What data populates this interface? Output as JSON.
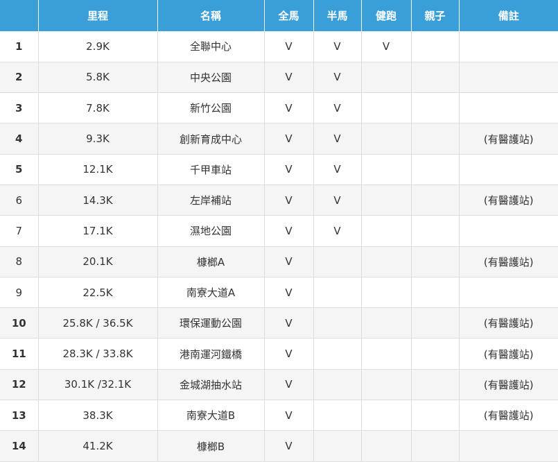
{
  "header": [
    "",
    "里程",
    "名稱",
    "全馬",
    "半馬",
    "健跑",
    "親子",
    "備註"
  ],
  "rows": [
    {
      "idx": "1",
      "bold": true,
      "dist": "2.9K",
      "name": "全聯中心",
      "full": "V",
      "half": "V",
      "fun": "V",
      "kids": "",
      "note": ""
    },
    {
      "idx": "2",
      "bold": true,
      "dist": "5.8K",
      "name": "中央公園",
      "full": "V",
      "half": "V",
      "fun": "",
      "kids": "",
      "note": ""
    },
    {
      "idx": "3",
      "bold": true,
      "dist": "7.8K",
      "name": "新竹公園",
      "full": "V",
      "half": "V",
      "fun": "",
      "kids": "",
      "note": ""
    },
    {
      "idx": "4",
      "bold": true,
      "dist": "9.3K",
      "name": "創新育成中心",
      "full": "V",
      "half": "V",
      "fun": "",
      "kids": "",
      "note": "(有醫護站)"
    },
    {
      "idx": "5",
      "bold": true,
      "dist": "12.1K",
      "name": "千甲車站",
      "full": "V",
      "half": "V",
      "fun": "",
      "kids": "",
      "note": ""
    },
    {
      "idx": "6",
      "bold": false,
      "dist": "14.3K",
      "name": "左岸補站",
      "full": "V",
      "half": "V",
      "fun": "",
      "kids": "",
      "note": "(有醫護站)"
    },
    {
      "idx": "7",
      "bold": false,
      "dist": "17.1K",
      "name": "濕地公園",
      "full": "V",
      "half": "V",
      "fun": "",
      "kids": "",
      "note": ""
    },
    {
      "idx": "8",
      "bold": false,
      "dist": "20.1K",
      "name": "槺榔A",
      "full": "V",
      "half": "",
      "fun": "",
      "kids": "",
      "note": "(有醫護站)"
    },
    {
      "idx": "9",
      "bold": false,
      "dist": "22.5K",
      "name": "南寮大道A",
      "full": "V",
      "half": "",
      "fun": "",
      "kids": "",
      "note": ""
    },
    {
      "idx": "10",
      "bold": true,
      "dist": "25.8K / 36.5K",
      "name": "環保運動公園",
      "full": "V",
      "half": "",
      "fun": "",
      "kids": "",
      "note": "(有醫護站)"
    },
    {
      "idx": "11",
      "bold": true,
      "dist": "28.3K / 33.8K",
      "name": "港南運河鐵橋",
      "full": "V",
      "half": "",
      "fun": "",
      "kids": "",
      "note": "(有醫護站)"
    },
    {
      "idx": "12",
      "bold": true,
      "dist": "30.1K /32.1K",
      "name": "金城湖抽水站",
      "full": "V",
      "half": "",
      "fun": "",
      "kids": "",
      "note": "(有醫護站)"
    },
    {
      "idx": "13",
      "bold": true,
      "dist": "38.3K",
      "name": "南寮大道B",
      "full": "V",
      "half": "",
      "fun": "",
      "kids": "",
      "note": "(有醫護站)"
    },
    {
      "idx": "14",
      "bold": true,
      "dist": "41.2K",
      "name": "槺榔B",
      "full": "V",
      "half": "",
      "fun": "",
      "kids": "",
      "note": ""
    }
  ]
}
